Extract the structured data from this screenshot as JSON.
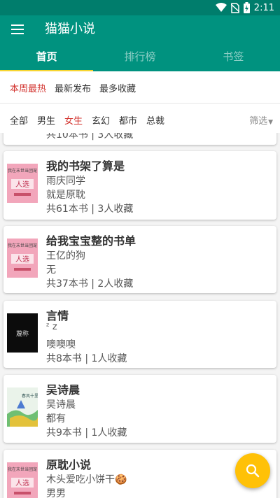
{
  "status": {
    "time": "2:11"
  },
  "app": {
    "title": "猫猫小说"
  },
  "tabs": [
    "首页",
    "排行榜",
    "书签"
  ],
  "sort_options": [
    "本周最热",
    "最新发布",
    "最多收藏"
  ],
  "categories": [
    "全部",
    "男生",
    "女生",
    "玄幻",
    "都市",
    "总裁"
  ],
  "filter_label": "筛选",
  "partial_item": {
    "stats": "共10本书 | 3人收藏"
  },
  "booklists": [
    {
      "title": "我的书架了算是",
      "author": "雨庆同学",
      "desc": "就是原耽",
      "stats": "共61本书 | 3人收藏"
    },
    {
      "title": "给我宝宝整的书单",
      "author": "王亿的狗",
      "desc": "无",
      "stats": "共37本书 | 2人收藏"
    },
    {
      "title": "言情",
      "author": "ᶻ z",
      "desc": "噢噢噢",
      "stats": "共8本书 | 1人收藏"
    },
    {
      "title": "吴诗晨",
      "author": "吴诗晨",
      "desc": "都有",
      "stats": "共9本书 | 1人收藏"
    },
    {
      "title": "原耽小说",
      "author": "木头爱吃小饼干🍪",
      "desc": "男男",
      "stats": ""
    }
  ],
  "covers": {
    "pink_top": "我在末世当团宠",
    "pink_main": "人选",
    "dark": "蔑称",
    "painting": "春风十里"
  },
  "colors": {
    "primary": "#00927f",
    "status": "#007d6c",
    "accent": "#f7d531",
    "active_text": "#d2322d",
    "fab": "#ffc107"
  }
}
